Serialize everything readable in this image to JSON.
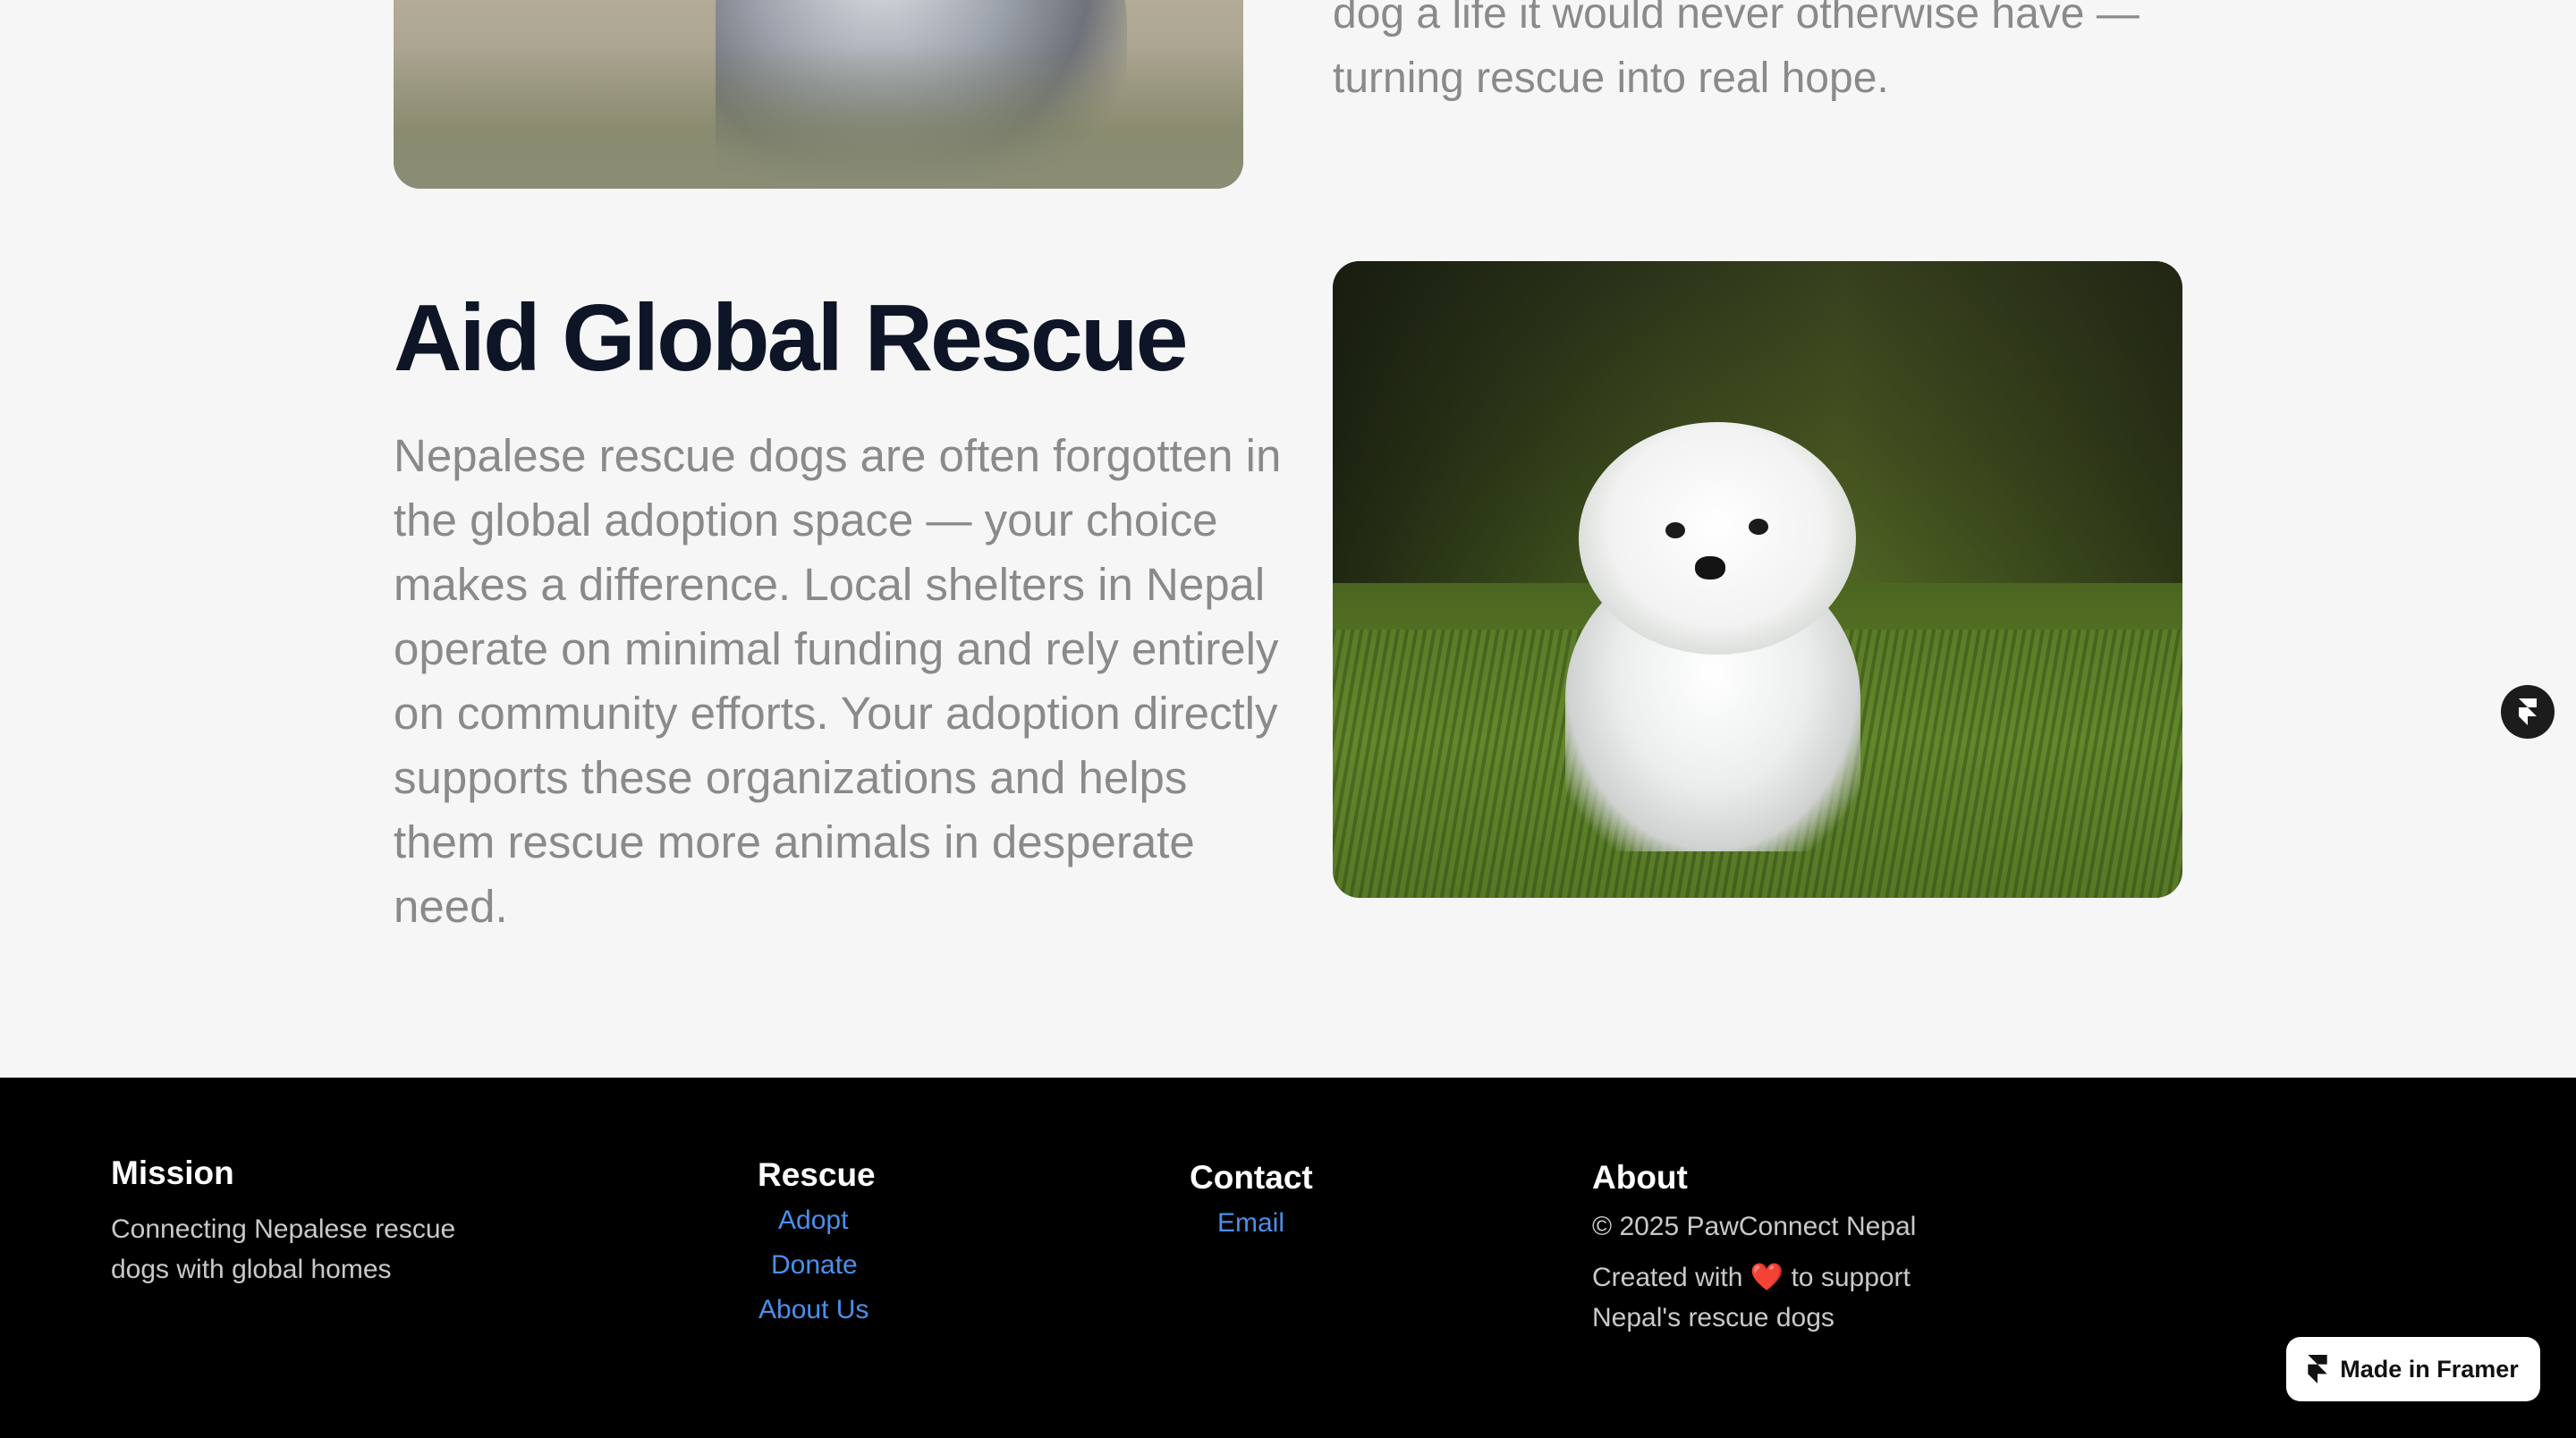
{
  "story_top": {
    "text_line1": "dog a life it would never otherwise have —",
    "text_line2": "turning rescue into real hope."
  },
  "section": {
    "title": "Aid Global Rescue",
    "body": "Nepalese rescue dogs are often forgotten in the global adoption space — your choice makes a difference. Local shelters in Nepal operate on minimal funding and rely entirely on community efforts. Your adoption directly supports these organizations and helps them rescue more animals in desperate need."
  },
  "footer": {
    "mission": {
      "heading": "Mission",
      "text": "Connecting Nepalese rescue dogs with global homes"
    },
    "rescue": {
      "heading": "Rescue",
      "links": [
        "Adopt",
        "Donate",
        "About Us"
      ]
    },
    "contact": {
      "heading": "Contact",
      "links": [
        "Email"
      ]
    },
    "about": {
      "heading": "About",
      "copyright": "© 2025 PawConnect Nepal",
      "created_before": "Created with",
      "heart": "❤️",
      "created_after": "to support Nepal's rescue dogs"
    }
  },
  "badge": {
    "label": "Made in Framer",
    "icon": "framer-logo-icon"
  },
  "colors": {
    "background": "#f6f6f6",
    "heading": "#0d1526",
    "body_text": "#8a8a8a",
    "footer_bg": "#000000",
    "link": "#4a90ec"
  }
}
